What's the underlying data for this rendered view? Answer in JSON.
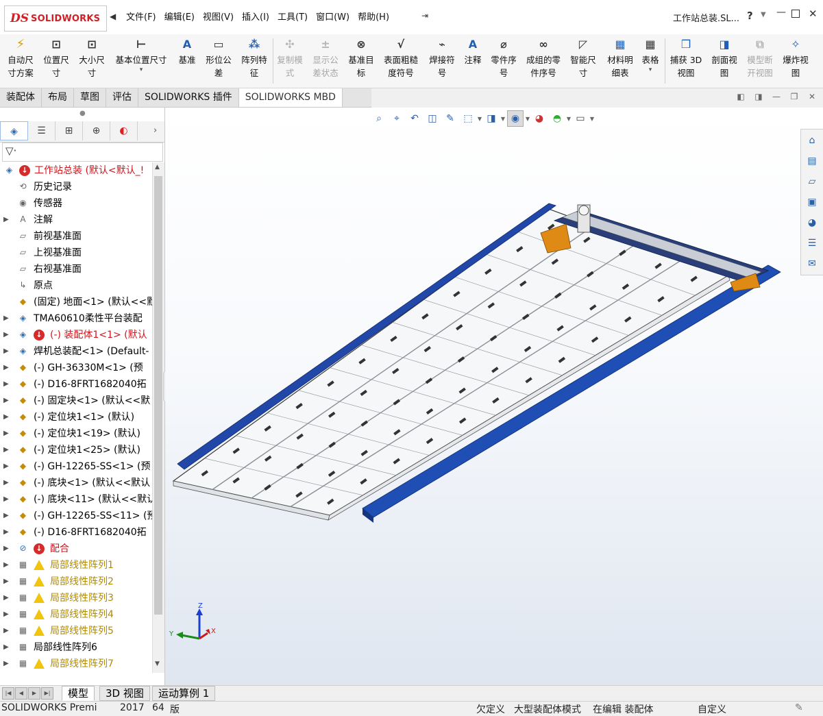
{
  "app": {
    "logo_ds": "DS",
    "logo_text": "SOLIDWORKS",
    "doc_title": "工作站总装.SL...",
    "help": "?"
  },
  "menu": [
    "文件(F)",
    "编辑(E)",
    "视图(V)",
    "插入(I)",
    "工具(T)",
    "窗口(W)",
    "帮助(H)"
  ],
  "ribbon": {
    "buttons": [
      {
        "label": "自动尺\n寸方案",
        "icon": "auto-dimension-icon",
        "enabled": true
      },
      {
        "label": "位置尺\n寸",
        "icon": "location-dimension-icon",
        "enabled": true
      },
      {
        "label": "大小尺\n寸",
        "icon": "size-dimension-icon",
        "enabled": true
      },
      {
        "label": "基本位置尺寸",
        "icon": "basic-location-dimension-icon",
        "enabled": true,
        "dropdown": true
      },
      {
        "label": "基准",
        "icon": "datum-icon",
        "enabled": true
      },
      {
        "label": "形位公\n差",
        "icon": "geometric-tolerance-icon",
        "enabled": true
      },
      {
        "label": "阵列特\n征",
        "icon": "pattern-feature-icon",
        "enabled": true
      },
      {
        "label": "复制模\n式",
        "icon": "copy-scheme-icon",
        "enabled": false
      },
      {
        "label": "显示公\n差状态",
        "icon": "show-tolerance-status-icon",
        "enabled": false
      },
      {
        "label": "基准目\n标",
        "icon": "datum-target-icon",
        "enabled": true
      },
      {
        "label": "表面粗糙\n度符号",
        "icon": "surface-finish-icon",
        "enabled": true
      },
      {
        "label": "焊接符\n号",
        "icon": "weld-symbol-icon",
        "enabled": true
      },
      {
        "label": "注释",
        "icon": "note-icon",
        "enabled": true
      },
      {
        "label": "零件序\n号",
        "icon": "balloon-icon",
        "enabled": true
      },
      {
        "label": "成组的零\n件序号",
        "icon": "stacked-balloon-icon",
        "enabled": true
      },
      {
        "label": "智能尺\n寸",
        "icon": "smart-dimension-icon",
        "enabled": true
      },
      {
        "label": "材料明\n细表",
        "icon": "bill-of-materials-icon",
        "enabled": true
      },
      {
        "label": "表格",
        "icon": "table-icon",
        "enabled": true,
        "dropdown": true
      },
      {
        "label": "捕获 3D\n视图",
        "icon": "capture-3d-view-icon",
        "enabled": true
      },
      {
        "label": "剖面视\n图",
        "icon": "section-view-icon",
        "enabled": true
      },
      {
        "label": "模型断\n开视图",
        "icon": "model-break-view-icon",
        "enabled": false
      },
      {
        "label": "爆炸视\n图",
        "icon": "exploded-view-icon",
        "enabled": true
      }
    ]
  },
  "command_tabs": [
    {
      "label": "装配体",
      "active": false
    },
    {
      "label": "布局",
      "active": false
    },
    {
      "label": "草图",
      "active": false
    },
    {
      "label": "评估",
      "active": false
    },
    {
      "label": "SOLIDWORKS 插件",
      "active": false
    },
    {
      "label": "SOLIDWORKS MBD",
      "active": true
    }
  ],
  "tree": {
    "root": "工作站总装 (默认<默认_!",
    "items": [
      {
        "text": "历史记录",
        "icon": "history-icon",
        "expand": false,
        "style": "normal"
      },
      {
        "text": "传感器",
        "icon": "sensor-icon",
        "expand": false,
        "style": "normal"
      },
      {
        "text": "注解",
        "icon": "annotation-icon",
        "expand": true,
        "style": "normal"
      },
      {
        "text": "前视基准面",
        "icon": "plane-icon",
        "expand": false,
        "style": "normal"
      },
      {
        "text": "上视基准面",
        "icon": "plane-icon",
        "expand": false,
        "style": "normal"
      },
      {
        "text": "右视基准面",
        "icon": "plane-icon",
        "expand": false,
        "style": "normal"
      },
      {
        "text": "原点",
        "icon": "origin-icon",
        "expand": false,
        "style": "normal"
      },
      {
        "text": "(固定) 地面<1> (默认<<默",
        "icon": "part-icon",
        "expand": false,
        "style": "normal"
      },
      {
        "text": "TMA60610柔性平台装配",
        "icon": "assembly-icon",
        "expand": true,
        "style": "normal"
      },
      {
        "text": "(-) 装配体1<1> (默认",
        "icon": "assembly-icon",
        "expand": true,
        "style": "red"
      },
      {
        "text": "焊机总装配<1> (Default-",
        "icon": "assembly-icon",
        "expand": true,
        "style": "normal"
      },
      {
        "text": "(-) GH-36330M<1> (预",
        "icon": "part-icon",
        "expand": true,
        "style": "normal"
      },
      {
        "text": "(-) D16-8FRT1682040拓",
        "icon": "part-icon",
        "expand": true,
        "style": "normal"
      },
      {
        "text": "(-) 固定块<1> (默认<<默",
        "icon": "part-icon",
        "expand": true,
        "style": "normal"
      },
      {
        "text": "(-) 定位块1<1> (默认)",
        "icon": "part-icon",
        "expand": true,
        "style": "normal"
      },
      {
        "text": "(-) 定位块1<19> (默认)",
        "icon": "part-icon",
        "expand": true,
        "style": "normal"
      },
      {
        "text": "(-) 定位块1<25> (默认)",
        "icon": "part-icon",
        "expand": true,
        "style": "normal"
      },
      {
        "text": "(-) GH-12265-SS<1> (预",
        "icon": "part-icon",
        "expand": true,
        "style": "normal"
      },
      {
        "text": "(-) 底块<1> (默认<<默认",
        "icon": "part-icon",
        "expand": true,
        "style": "normal"
      },
      {
        "text": "(-) 底块<11> (默认<<默认",
        "icon": "part-icon",
        "expand": true,
        "style": "normal"
      },
      {
        "text": "(-) GH-12265-SS<11> (预",
        "icon": "part-icon",
        "expand": true,
        "style": "normal"
      },
      {
        "text": "(-) D16-8FRT1682040拓",
        "icon": "part-icon",
        "expand": true,
        "style": "normal"
      },
      {
        "text": "配合",
        "icon": "mates-icon",
        "expand": true,
        "style": "red"
      },
      {
        "text": "局部线性阵列1",
        "icon": "linear-pattern-icon",
        "expand": true,
        "style": "warn"
      },
      {
        "text": "局部线性阵列2",
        "icon": "linear-pattern-icon",
        "expand": true,
        "style": "warn"
      },
      {
        "text": "局部线性阵列3",
        "icon": "linear-pattern-icon",
        "expand": true,
        "style": "warn"
      },
      {
        "text": "局部线性阵列4",
        "icon": "linear-pattern-icon",
        "expand": true,
        "style": "warn"
      },
      {
        "text": "局部线性阵列5",
        "icon": "linear-pattern-icon",
        "expand": true,
        "style": "warn"
      },
      {
        "text": "局部线性阵列6",
        "icon": "linear-pattern-icon",
        "expand": true,
        "style": "normal"
      },
      {
        "text": "局部线性阵列7",
        "icon": "linear-pattern-icon",
        "expand": true,
        "style": "warn"
      }
    ]
  },
  "bottom_tabs": [
    {
      "label": "模型",
      "active": true
    },
    {
      "label": "3D 视图",
      "active": false
    },
    {
      "label": "运动算例 1",
      "active": false
    }
  ],
  "status": {
    "product": "SOLIDWORKS Premi",
    "year": "2017",
    "bits": "64",
    "edition": "版",
    "under_defined": "欠定义",
    "mode": "大型装配体模式",
    "editing": "在编辑 装配体",
    "custom": "自定义"
  },
  "triad": {
    "x": "X",
    "y": "Y",
    "z": "Z"
  },
  "colors": {
    "brand_red": "#d11f26",
    "error_red": "#d0141c",
    "warning_yellow": "#b08a00",
    "rail_blue": "#1f4fb5",
    "gantry_orange": "#e08a16"
  }
}
